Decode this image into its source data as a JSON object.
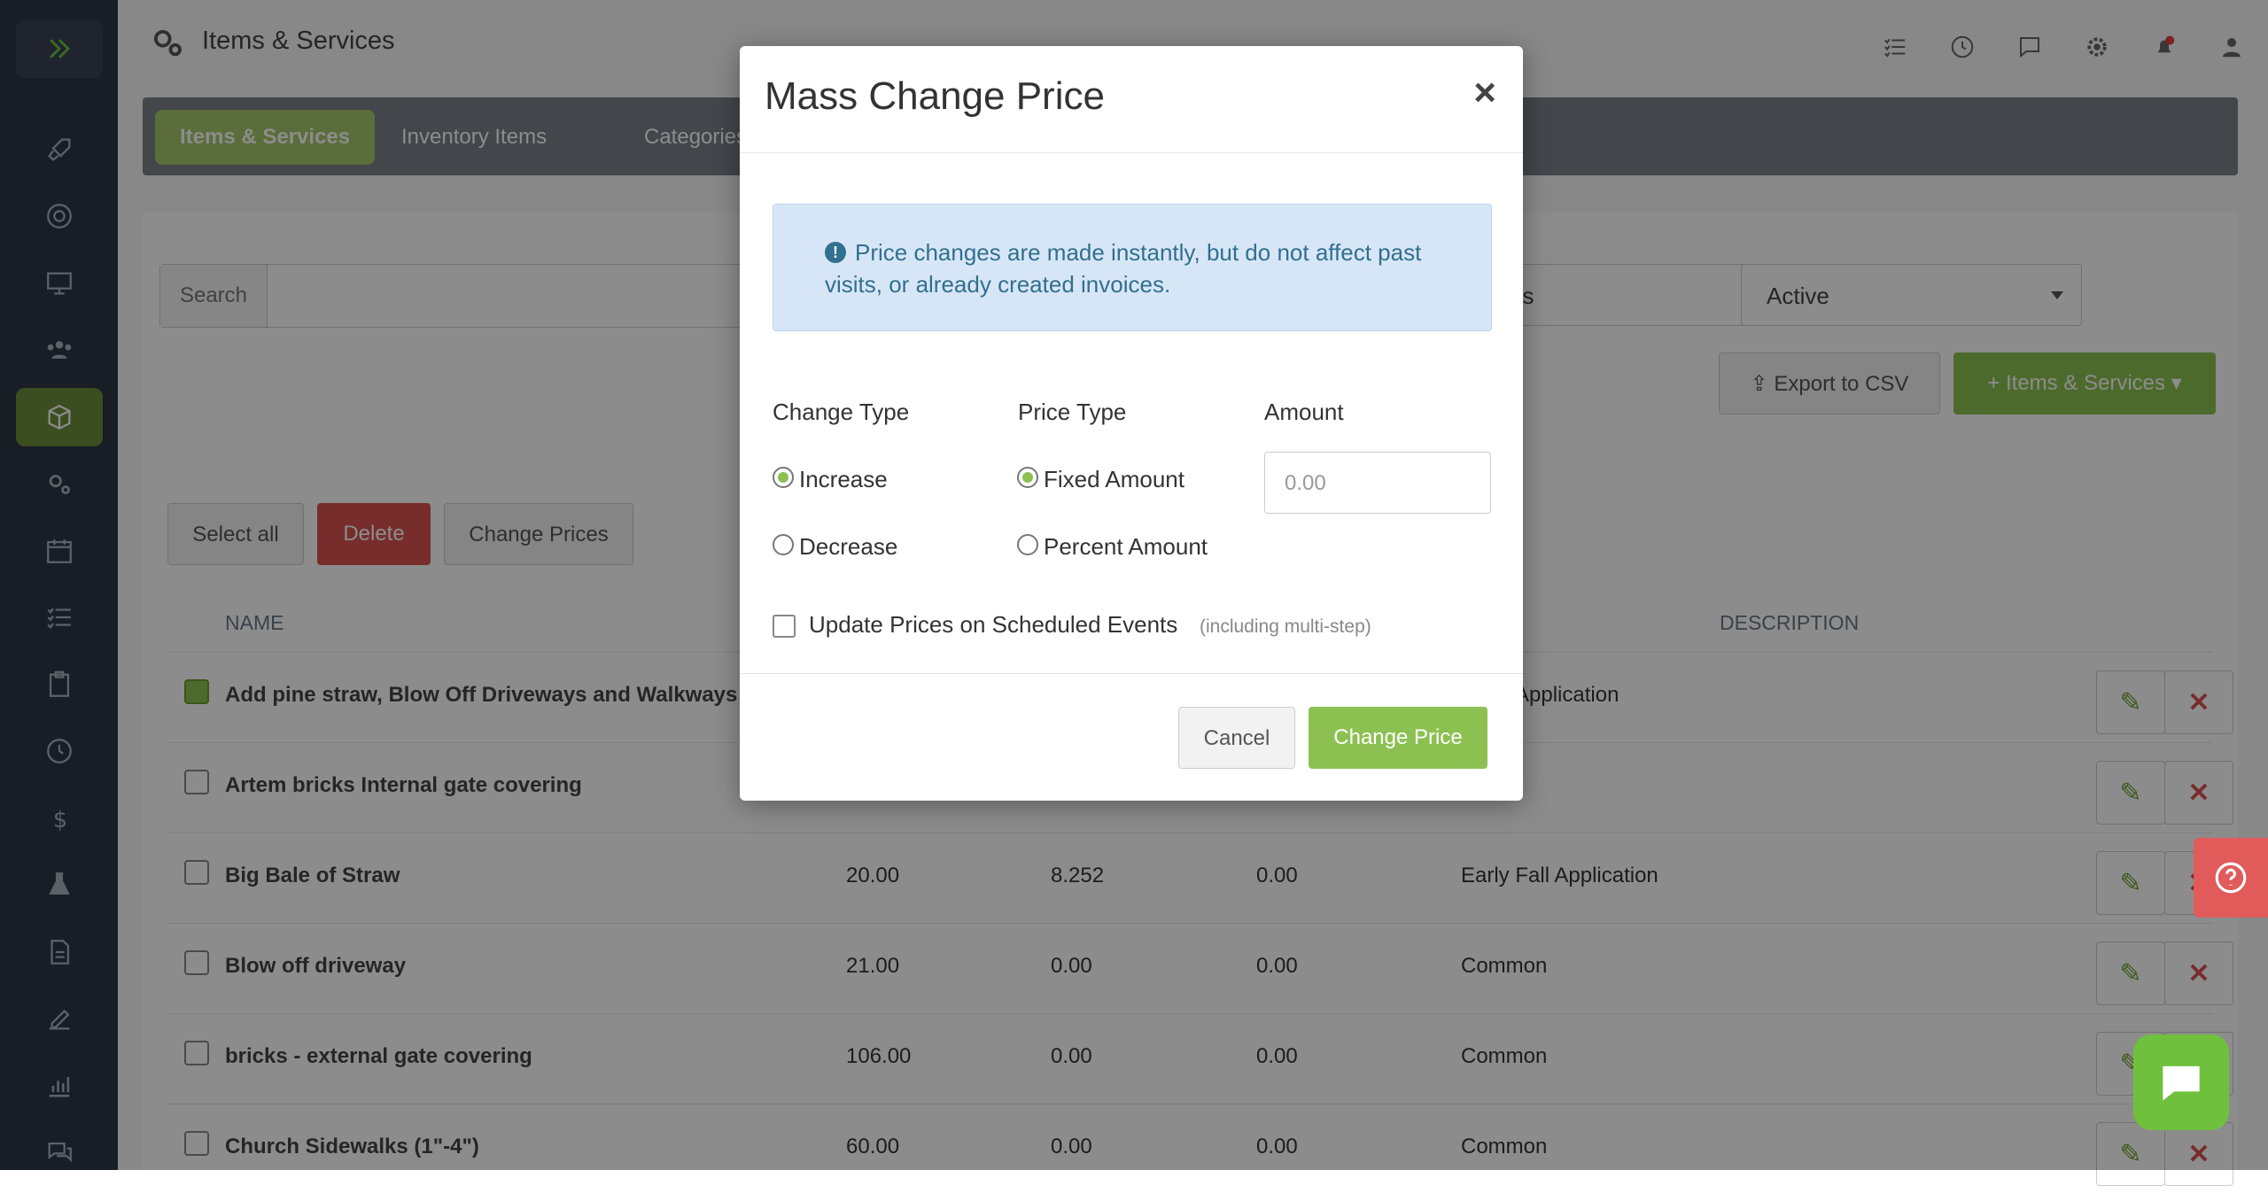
{
  "header": {
    "title": "Items & Services"
  },
  "tabs": [
    {
      "label": "Items & Services",
      "active": true
    },
    {
      "label": "Inventory Items",
      "active": false
    },
    {
      "label": "Categories",
      "active": false
    }
  ],
  "filters": {
    "search_label": "Search",
    "search_value": "",
    "types_select": "Types",
    "status_select": "Active"
  },
  "buttons": {
    "export": "Export to CSV",
    "add": "+ Items & Services",
    "select_all": "Select all",
    "delete": "Delete",
    "change_prices": "Change Prices"
  },
  "table": {
    "headers": {
      "name": "NAME",
      "description": "DESCRIPTION"
    },
    "rows": [
      {
        "name": "Add pine straw, Blow Off Driveways and Walkways",
        "price": "",
        "cost": "",
        "tax": "",
        "category": "Application",
        "checked": true
      },
      {
        "name": "Artem bricks Internal gate covering",
        "price": "",
        "cost": "",
        "tax": "",
        "category": "",
        "checked": false
      },
      {
        "name": "Big Bale of Straw",
        "price": "20.00",
        "cost": "8.252",
        "tax": "0.00",
        "category": "Early Fall Application",
        "checked": false
      },
      {
        "name": "Blow off driveway",
        "price": "21.00",
        "cost": "0.00",
        "tax": "0.00",
        "category": "Common",
        "checked": false
      },
      {
        "name": "bricks - external gate covering",
        "price": "106.00",
        "cost": "0.00",
        "tax": "0.00",
        "category": "Common",
        "checked": false
      },
      {
        "name": "Church Sidewalks (1\"-4\")",
        "price": "60.00",
        "cost": "0.00",
        "tax": "0.00",
        "category": "Common",
        "checked": false
      }
    ]
  },
  "modal": {
    "title": "Mass Change Price",
    "close": "×",
    "alert_icon": "!",
    "alert": "Price changes are made instantly, but do not affect past visits, or already created invoices.",
    "change_type": {
      "label": "Change Type",
      "options": [
        {
          "label": "Increase",
          "selected": true
        },
        {
          "label": "Decrease",
          "selected": false
        }
      ]
    },
    "price_type": {
      "label": "Price Type",
      "options": [
        {
          "label": "Fixed Amount",
          "selected": true
        },
        {
          "label": "Percent Amount",
          "selected": false
        }
      ]
    },
    "amount": {
      "label": "Amount",
      "placeholder": "0.00"
    },
    "scheduled": {
      "label": "Update Prices on Scheduled Events",
      "hint": "(including multi-step)",
      "checked": false
    },
    "cancel": "Cancel",
    "submit": "Change Price"
  },
  "colors": {
    "accent": "#8cc152",
    "danger": "#d9534f",
    "sidebar": "#2f3645",
    "info": "#31708f"
  }
}
